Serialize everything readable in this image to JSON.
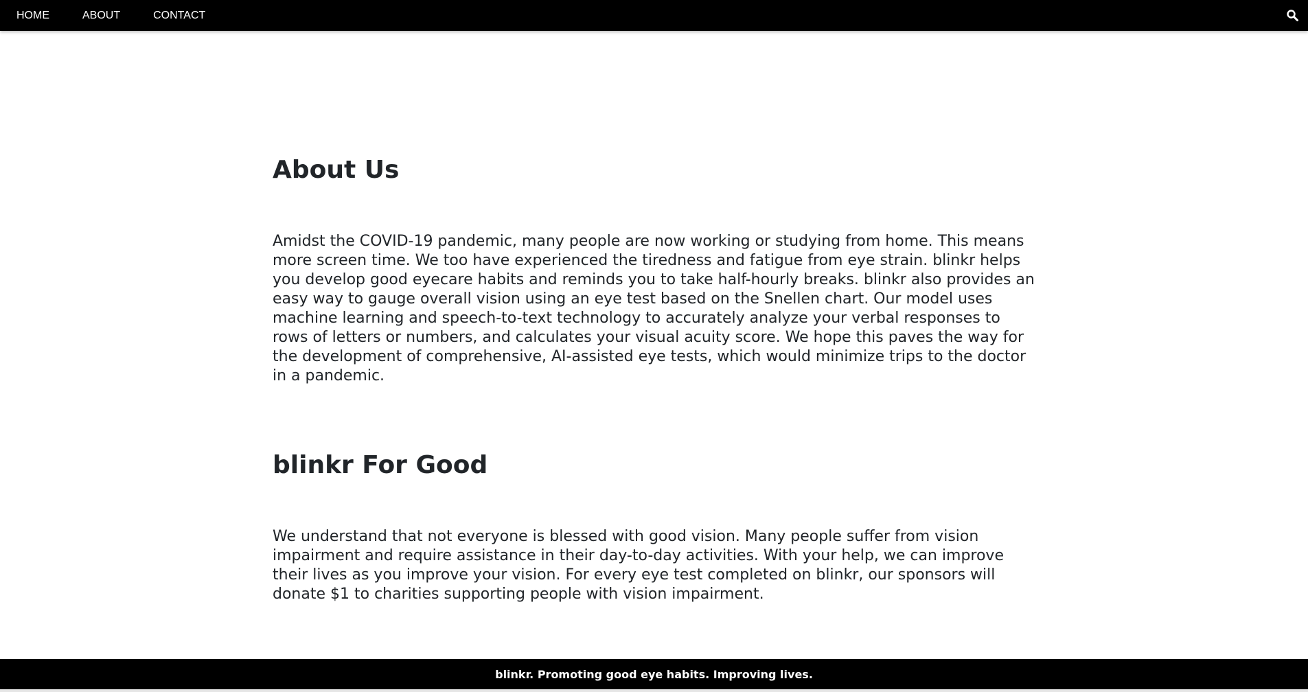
{
  "nav": {
    "items": [
      {
        "label": "HOME"
      },
      {
        "label": "ABOUT"
      },
      {
        "label": "CONTACT"
      }
    ],
    "search_icon": "search-icon"
  },
  "about": {
    "title": "About Us",
    "text": "Amidst the COVID-19 pandemic, many people are now working or studying from home. This means more screen time. We too have experienced the tiredness and fatigue from eye strain. blinkr helps you develop good eyecare habits and reminds you to take half-hourly breaks. blinkr also provides an easy way to gauge overall vision using an eye test based on the Snellen chart. Our model uses machine learning and speech-to-text technology to accurately analyze your verbal responses to rows of letters or numbers, and calculates your visual acuity score. We hope this paves the way for the development of comprehensive, AI-assisted eye tests, which would minimize trips to the doctor in a pandemic."
  },
  "good": {
    "title": "blinkr For Good",
    "text": "We understand that not everyone is blessed with good vision. Many people suffer from vision impairment and require assistance in their day-to-day activities. With your help, we can improve their lives as you improve your vision. For every eye test completed on blinkr, our sponsors will donate $1 to charities supporting people with vision impairment."
  },
  "footer": {
    "text": "blinkr. Promoting good eye habits. Improving lives."
  },
  "colors": {
    "nav_bg": "#000000",
    "text": "#212529",
    "footer_bg": "#000000"
  }
}
